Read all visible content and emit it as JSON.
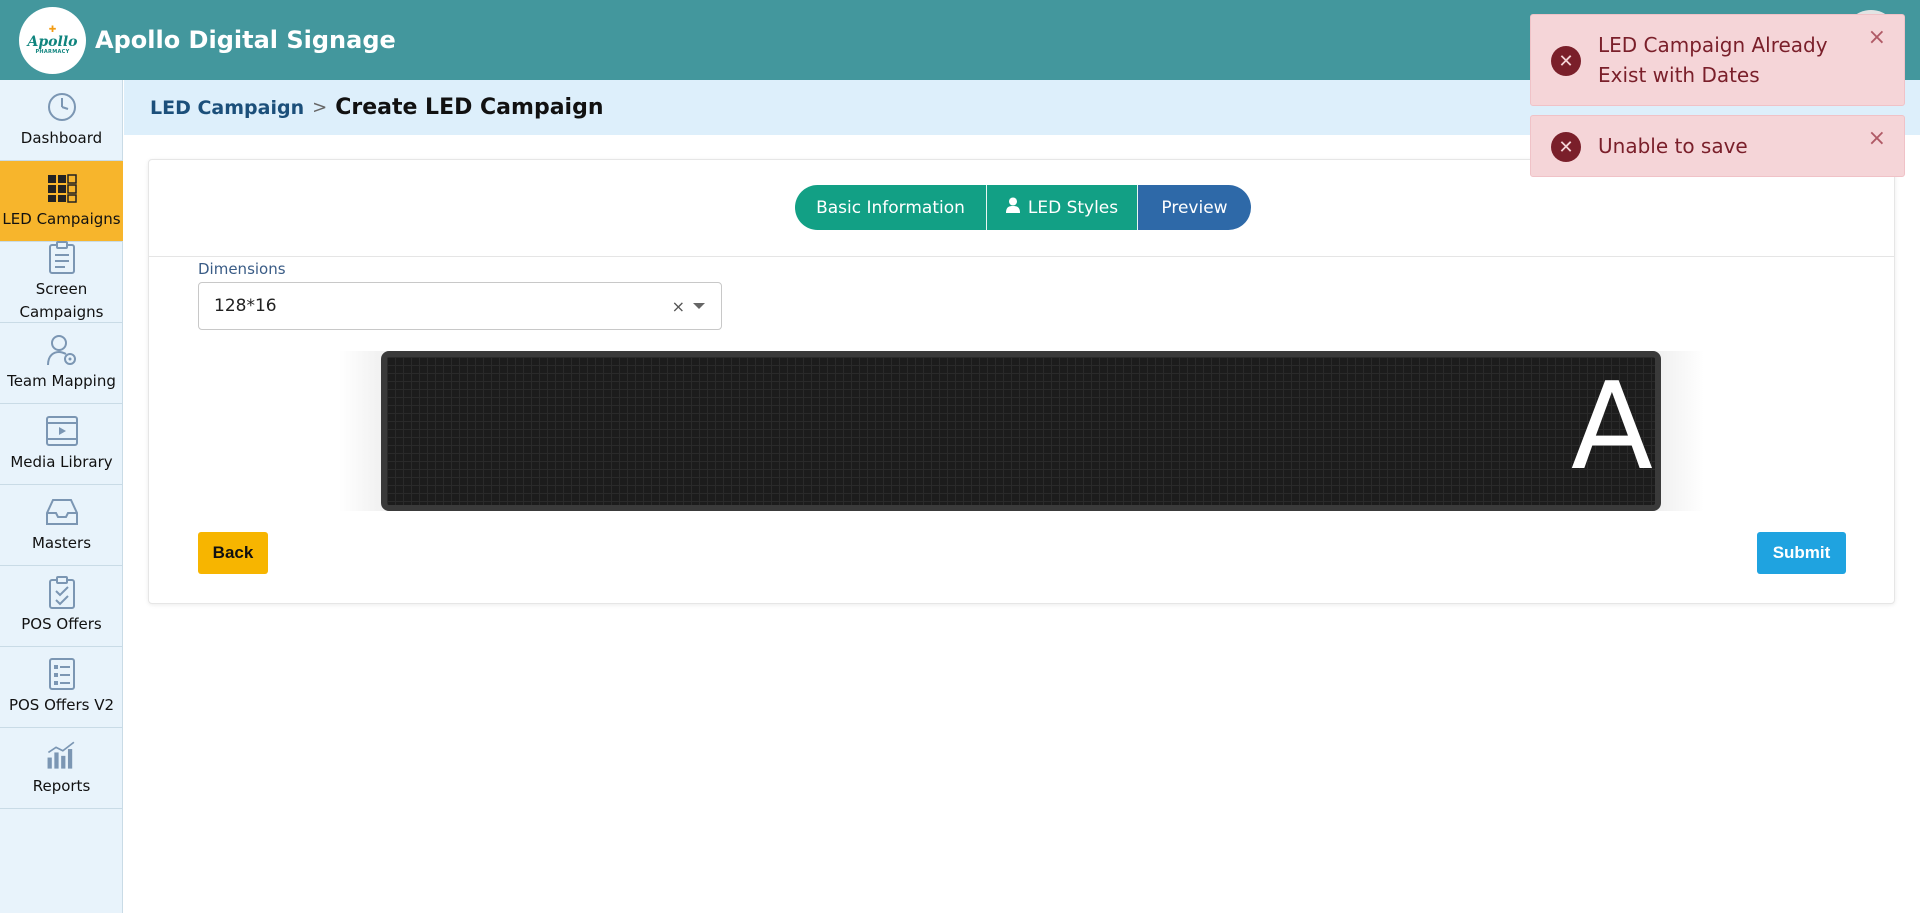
{
  "header": {
    "app_title": "Apollo Digital Signage",
    "logo_text": "Apollo",
    "logo_subtext": "PHARMACY"
  },
  "sidebar": {
    "items": [
      {
        "label": "Dashboard",
        "icon": "dashboard-icon",
        "active": false
      },
      {
        "label": "LED Campaigns",
        "icon": "led-grid-icon",
        "active": true
      },
      {
        "label": "Screen Campaigns",
        "icon": "clipboard-icon",
        "active": false
      },
      {
        "label": "Team Mapping",
        "icon": "user-gear-icon",
        "active": false
      },
      {
        "label": "Media Library",
        "icon": "video-icon",
        "active": false
      },
      {
        "label": "Masters",
        "icon": "inbox-icon",
        "active": false
      },
      {
        "label": "POS Offers",
        "icon": "clipboard-check-icon",
        "active": false
      },
      {
        "label": "POS Offers V2",
        "icon": "list-doc-icon",
        "active": false
      },
      {
        "label": "Reports",
        "icon": "bar-chart-icon",
        "active": false
      }
    ]
  },
  "breadcrumb": {
    "parent": "LED Campaign",
    "separator": ">",
    "current": "Create LED Campaign"
  },
  "tabs": {
    "basic": "Basic Information",
    "styles": "LED Styles",
    "preview": "Preview",
    "active": "preview"
  },
  "form": {
    "dimensions_label": "Dimensions",
    "dimensions_value": "128*16",
    "clear_symbol": "×"
  },
  "led_preview": {
    "text": "A"
  },
  "buttons": {
    "back": "Back",
    "submit": "Submit"
  },
  "toasts": [
    {
      "message": "LED Campaign Already Exist with Dates",
      "close": "×"
    },
    {
      "message": "Unable to save",
      "close": "×"
    }
  ],
  "colors": {
    "header": "#43979d",
    "sidebar_active": "#f7b52c",
    "tab_green": "#12a085",
    "tab_active": "#2e69a8",
    "back_button": "#f7b500",
    "submit_button": "#1fa3e0",
    "toast_bg": "#f5d5d8",
    "toast_text": "#7a1f2a"
  }
}
